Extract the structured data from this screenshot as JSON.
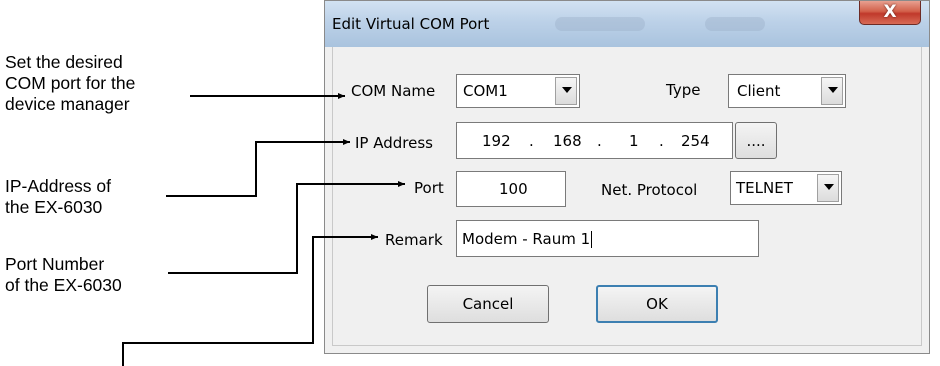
{
  "annotations": {
    "com_port": [
      "Set the desired",
      "COM port for the",
      "device manager"
    ],
    "ip_address": [
      "IP-Address of",
      "the EX-6030"
    ],
    "port_number": [
      "Port Number",
      "of the EX-6030"
    ]
  },
  "dialog": {
    "title": "Edit Virtual COM Port",
    "close_label": "X",
    "com_name_label": "COM Name",
    "com_name_value": "COM1",
    "type_label": "Type",
    "type_value": "Client",
    "ip_label": "IP Address",
    "ip_octets": [
      "192",
      "168",
      "1",
      "254"
    ],
    "ip_separator": ".",
    "ip_browse_label": "....",
    "port_label": "Port",
    "port_value": "100",
    "protocol_label": "Net. Protocol",
    "protocol_value": "TELNET",
    "remark_label": "Remark",
    "remark_value": "Modem - Raum 1",
    "cancel_label": "Cancel",
    "ok_label": "OK"
  },
  "colors": {
    "titlebar": "#bcd1e8",
    "close_button": "#c0392b",
    "dialog_bg": "#f0f0f0",
    "ok_focus_border": "#3c7fb1"
  }
}
